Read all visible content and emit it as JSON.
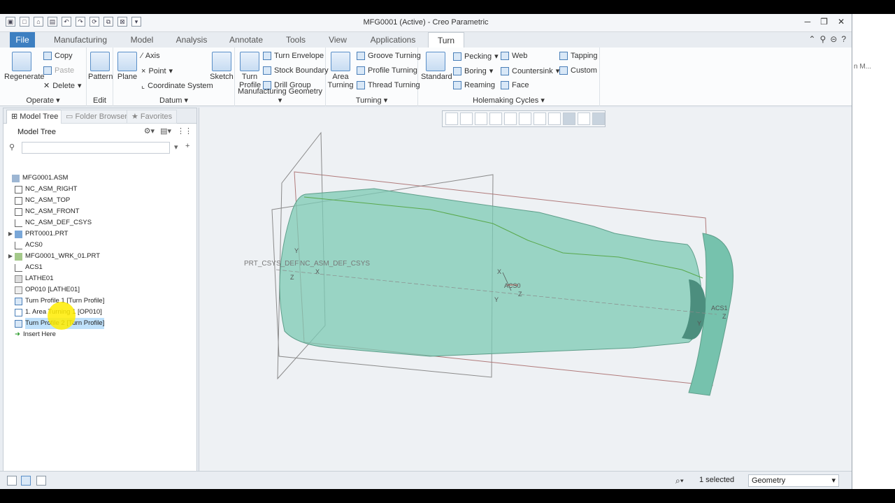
{
  "window": {
    "title": "MFG0001 (Active) - Creo Parametric"
  },
  "tabs": [
    {
      "label": "File"
    },
    {
      "label": "Manufacturing"
    },
    {
      "label": "Model"
    },
    {
      "label": "Analysis"
    },
    {
      "label": "Annotate"
    },
    {
      "label": "Tools"
    },
    {
      "label": "View"
    },
    {
      "label": "Applications"
    },
    {
      "label": "Turn"
    }
  ],
  "ribbon": {
    "operate": {
      "label": "Operate ▾",
      "regenerate": "Regenerate",
      "copy": "Copy",
      "paste": "Paste",
      "delete": "Delete"
    },
    "edit": {
      "label": "Edit",
      "pattern": "Pattern"
    },
    "datum": {
      "label": "Datum ▾",
      "plane": "Plane",
      "axis": "Axis",
      "point": "Point",
      "csys": "Coordinate System",
      "sketch": "Sketch"
    },
    "mfg_geometry": {
      "label": "Manufacturing Geometry ▾",
      "turn_profile_1": "Turn",
      "turn_profile_2": "Profile",
      "turn_envelope": "Turn Envelope",
      "stock_boundary": "Stock Boundary",
      "drill_group": "Drill Group"
    },
    "turning": {
      "label": "Turning ▾",
      "area_1": "Area",
      "area_2": "Turning",
      "groove": "Groove Turning",
      "profile": "Profile Turning",
      "thread": "Thread Turning"
    },
    "holemaking": {
      "label": "Holemaking Cycles ▾",
      "standard": "Standard",
      "pecking": "Pecking",
      "boring": "Boring",
      "reaming": "Reaming",
      "web": "Web",
      "countersink": "Countersink",
      "face": "Face",
      "tapping": "Tapping",
      "custom": "Custom"
    }
  },
  "sidebar": {
    "tabs": [
      {
        "label": "Model Tree"
      },
      {
        "label": "Folder Browser"
      },
      {
        "label": "Favorites"
      }
    ],
    "heading": "Model Tree",
    "filter_placeholder": "",
    "tree": [
      {
        "label": "MFG0001.ASM"
      },
      {
        "label": "NC_ASM_RIGHT"
      },
      {
        "label": "NC_ASM_TOP"
      },
      {
        "label": "NC_ASM_FRONT"
      },
      {
        "label": "NC_ASM_DEF_CSYS"
      },
      {
        "label": "PRT0001.PRT"
      },
      {
        "label": "ACS0"
      },
      {
        "label": "MFG0001_WRK_01.PRT"
      },
      {
        "label": "ACS1"
      },
      {
        "label": "LATHE01"
      },
      {
        "label": "OP010 [LATHE01]"
      },
      {
        "label": "Turn Profile 1 [Turn Profile]"
      },
      {
        "label": "1. Area Turning 1 [OP010]"
      },
      {
        "label": "Turn Profile 2 [Turn Profile]"
      },
      {
        "label": "Insert Here"
      }
    ]
  },
  "viewport": {
    "label_csys": "PRT_CSYS_DEF",
    "label_asm_csys": "NC_ASM_DEF_CSYS",
    "label_acs0": "ACS0",
    "label_acs1": "ACS1",
    "axis_x": "X",
    "axis_y": "Y",
    "axis_z": "Z"
  },
  "status": {
    "selected": "1 selected",
    "filter": "Geometry"
  },
  "colors": {
    "part": "#7ccab4",
    "file_tab": "#3d7fc1",
    "selection": "#bfe1fb"
  },
  "right_panel": {
    "text": "n M..."
  }
}
